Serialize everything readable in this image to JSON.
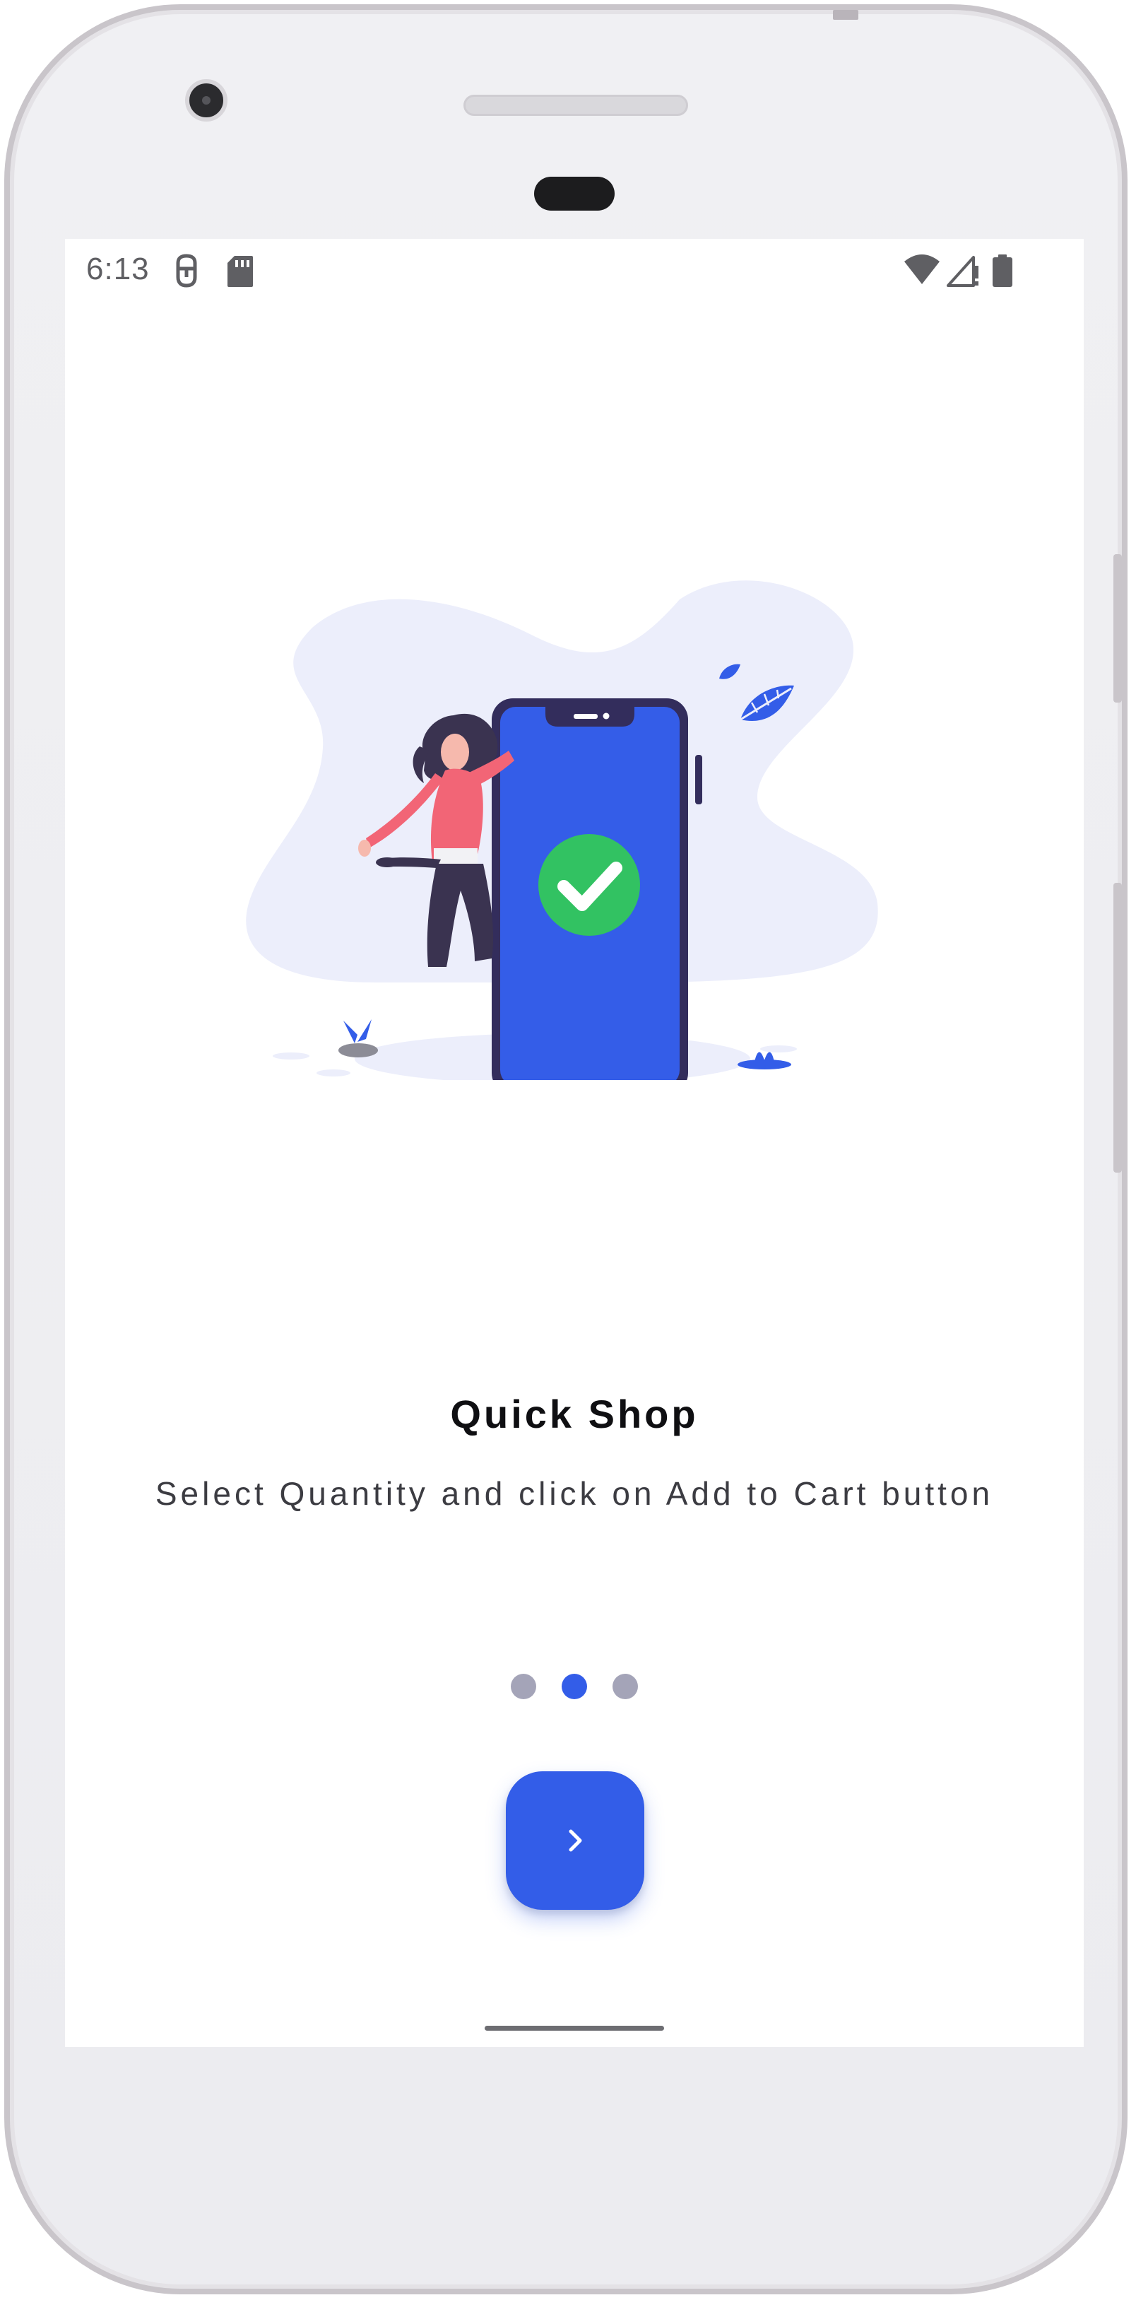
{
  "status_bar": {
    "time": "6:13",
    "left_icons": [
      "debug-icon",
      "sd-card-icon"
    ],
    "right_icons": [
      "wifi-icon",
      "signal-icon",
      "battery-icon"
    ]
  },
  "onboarding": {
    "title": "Quick Shop",
    "description": "Select Quantity and click on Add to Cart button",
    "page_count": 3,
    "active_page": 2,
    "next_button_icon": "chevron-right-icon"
  },
  "colors": {
    "accent": "#335de8",
    "dot_inactive": "#a4a4b8",
    "check_green": "#32c262",
    "blob": "#eceefb",
    "figure_shirt": "#f26576",
    "figure_dark": "#3a3350"
  }
}
